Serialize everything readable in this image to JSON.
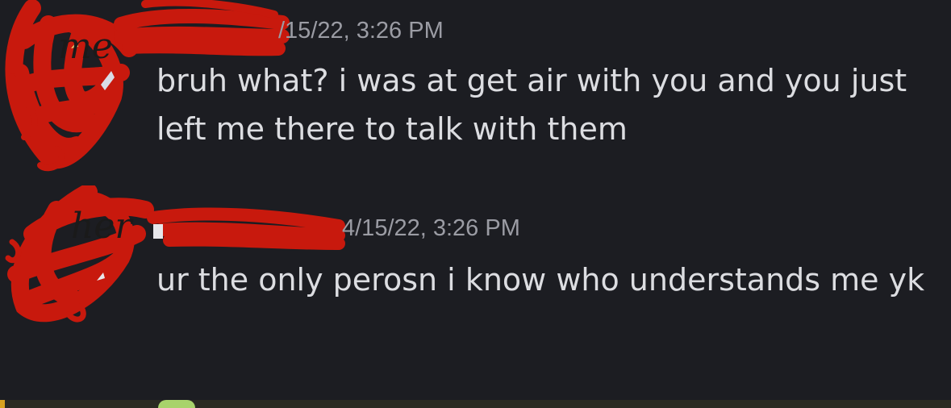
{
  "messages": [
    {
      "annotation": "me",
      "timestamp": "/15/22, 3:26 PM",
      "text": "bruh what? i was at get air with you and you just left me there to talk with them"
    },
    {
      "annotation": "her",
      "timestamp": "4/15/22, 3:26 PM",
      "text": "ur the only perosn i know who understands me yk"
    }
  ],
  "colors": {
    "background": "#1c1d22",
    "message_text": "#dcdde1",
    "timestamp_text": "#9b9ca4",
    "redaction_red": "#c8190d"
  }
}
